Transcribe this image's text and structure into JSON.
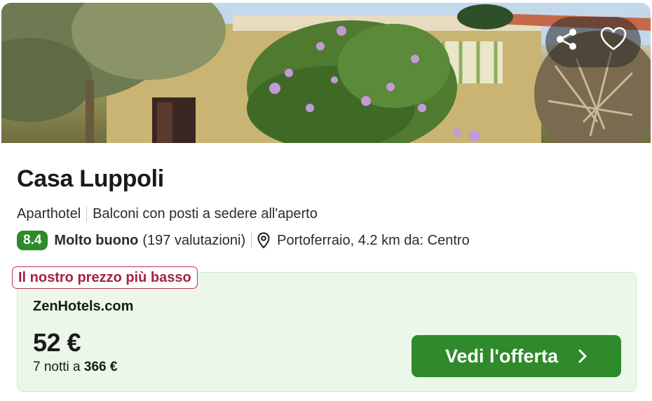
{
  "hotel": {
    "name": "Casa Luppoli",
    "type": "Aparthotel",
    "feature": "Balconi con posti a sedere all'aperto",
    "score": "8.4",
    "rating_label": "Molto buono",
    "reviews": "(197 valutazioni)",
    "location": "Portoferraio, 4.2 km da: Centro"
  },
  "photo_actions": {
    "share_icon": "share-icon",
    "favorite_icon": "heart-icon"
  },
  "deal": {
    "badge": "Il nostro prezzo più basso",
    "provider": "ZenHotels.com",
    "price": "52 €",
    "total_prefix": "7 notti a",
    "total_amount": "366 €",
    "cta_label": "Vedi l'offerta"
  },
  "colors": {
    "accent_green": "#2e8a2a",
    "deal_background": "#ebf8e9",
    "badge_red": "#a5213f"
  }
}
